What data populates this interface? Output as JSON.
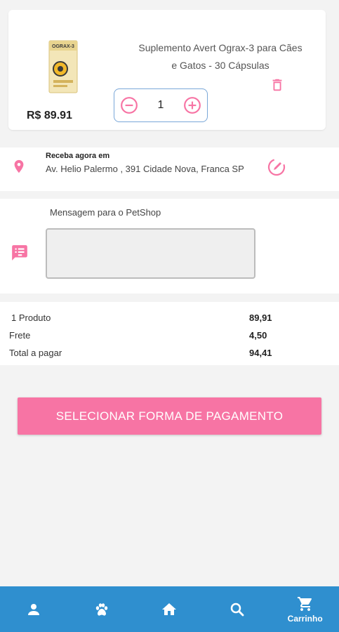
{
  "product": {
    "name": "Suplemento Avert Ograx-3 para Cães e Gatos - 30 Cápsulas",
    "price": "R$ 89.91",
    "quantity": "1",
    "box_text": "OGRAX-3"
  },
  "address": {
    "label": "Receba agora em",
    "text": "Av. Helio Palermo , 391 Cidade Nova, Franca SP"
  },
  "message": {
    "label": "Mensagem para o PetShop",
    "value": ""
  },
  "totals": {
    "rows": [
      {
        "label": "1 Produto",
        "value": "89,91"
      },
      {
        "label": "Frete",
        "value": "4,50"
      },
      {
        "label": "Total a pagar",
        "value": "94,41"
      }
    ]
  },
  "payment_button": "SELECIONAR FORMA DE PAGAMENTO",
  "nav": {
    "items": [
      {
        "icon": "person-icon",
        "label": ""
      },
      {
        "icon": "paw-icon",
        "label": ""
      },
      {
        "icon": "home-icon",
        "label": ""
      },
      {
        "icon": "search-icon",
        "label": ""
      },
      {
        "icon": "cart-icon",
        "label": "Carrinho"
      }
    ]
  },
  "colors": {
    "accent": "#f774a4",
    "nav_bg": "#2f8fcf",
    "qty_border": "#7aa7d8"
  }
}
